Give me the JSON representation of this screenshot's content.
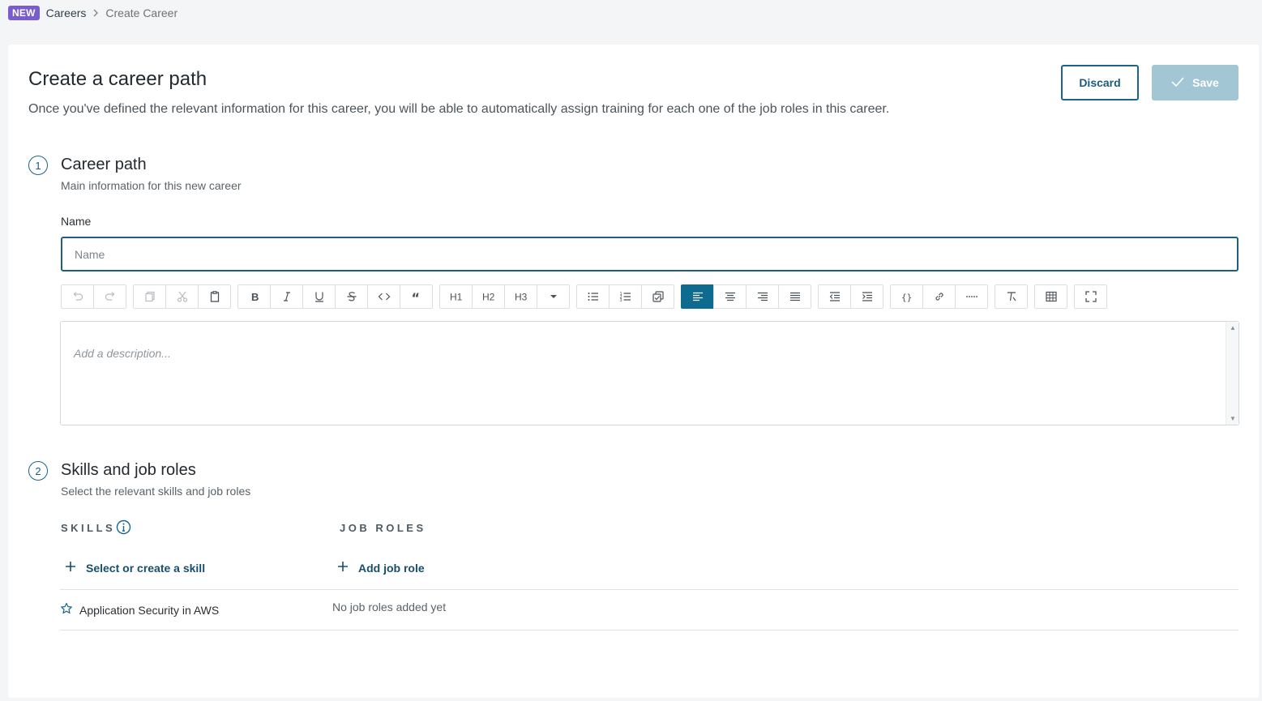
{
  "breadcrumb": {
    "badge": "NEW",
    "parent": "Careers",
    "current": "Create Career"
  },
  "header": {
    "title": "Create a career path",
    "subtitle": "Once you've defined the relevant information for this career, you will be able to automatically assign training for each one of the job roles in this career.",
    "discard_label": "Discard",
    "save_label": "Save"
  },
  "section1": {
    "number": "1",
    "title": "Career path",
    "subtitle": "Main information for this new career",
    "name_label": "Name",
    "name_placeholder": "Name",
    "name_value": "",
    "description_placeholder": "Add a description...",
    "toolbar": [
      [
        "undo-icon",
        "redo-icon"
      ],
      [
        "copy-icon",
        "cut-icon",
        "paste-icon"
      ],
      [
        "bold-icon",
        "italic-icon",
        "underline-icon",
        "strikethrough-icon",
        "code-icon",
        "quote-icon"
      ],
      [
        "heading-1-icon",
        "heading-2-icon",
        "heading-3-icon",
        "more-headings-icon"
      ],
      [
        "bullet-list-icon",
        "numbered-list-icon",
        "checklist-icon"
      ],
      [
        "align-left-icon",
        "align-center-icon",
        "align-right-icon",
        "align-justify-icon"
      ],
      [
        "outdent-icon",
        "indent-icon"
      ],
      [
        "code-block-icon",
        "link-icon",
        "horizontal-rule-icon"
      ],
      [
        "clear-format-icon"
      ],
      [
        "table-icon"
      ],
      [
        "fullscreen-icon"
      ]
    ],
    "active_tool": "align-left-icon"
  },
  "section2": {
    "number": "2",
    "title": "Skills and job roles",
    "subtitle": "Select the relevant skills and job roles",
    "skills_header": "SKILLS",
    "roles_header": "JOB ROLES",
    "add_skill_label": "Select or create a skill",
    "add_role_label": "Add job role",
    "skills": [
      "Application Security in AWS"
    ],
    "empty_roles_text": "No job roles added yet"
  },
  "colors": {
    "accent": "#0f6a90",
    "badge": "#7a5ccc",
    "save_disabled": "#a3c6d4"
  }
}
